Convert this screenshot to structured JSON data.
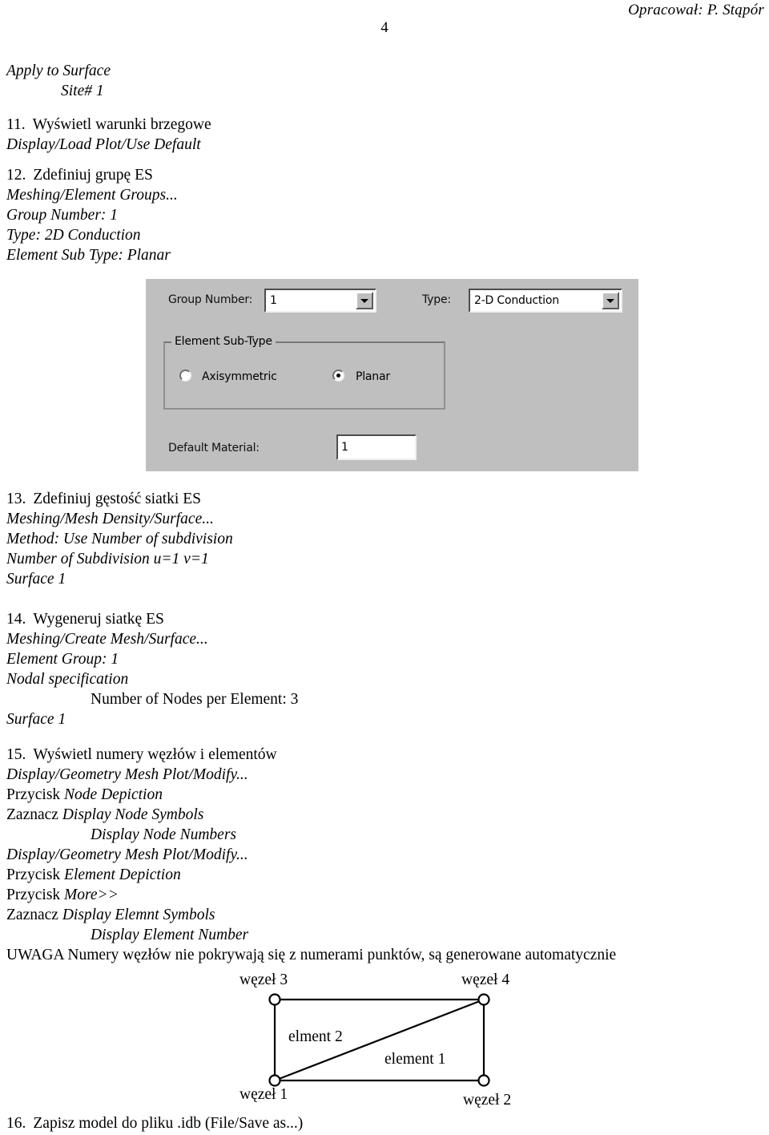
{
  "header": {
    "author": "Opracował:  P. Stąpór",
    "page_number": "4"
  },
  "top_block": {
    "line1": "Apply to Surface",
    "line2": "Site# 1"
  },
  "steps": [
    {
      "number": "11.",
      "title": "Wyświetl warunki brzegowe",
      "lines": [
        {
          "text": "Display/Load Plot/Use Default",
          "style": "italic",
          "indent": 0
        }
      ]
    },
    {
      "number": "12.",
      "title": "Zdefiniuj grupę ES",
      "lines": [
        {
          "text": "Meshing/Element Groups...",
          "style": "italic",
          "indent": 0
        },
        {
          "text": "Group Number: 1",
          "style": "italic",
          "indent": 0
        },
        {
          "text": "Type: 2D Conduction",
          "style": "italic",
          "indent": 0
        },
        {
          "text": "Element Sub Type: Planar",
          "style": "italic",
          "indent": 0
        }
      ]
    },
    {
      "number": "13.",
      "title": "Zdefiniuj gęstość siatki ES",
      "lines": [
        {
          "text": "Meshing/Mesh Density/Surface...",
          "style": "italic",
          "indent": 0
        },
        {
          "text": "Method: Use Number of subdivision",
          "style": "italic",
          "indent": 0
        },
        {
          "text": "Number of Subdivision u=1 v=1",
          "style": "italic",
          "indent": 0
        },
        {
          "text": "Surface 1",
          "style": "italic",
          "indent": 0
        }
      ]
    },
    {
      "number": "14.",
      "title": "Wygeneruj siatkę ES",
      "lines": [
        {
          "text": "Meshing/Create Mesh/Surface...",
          "style": "italic",
          "indent": 0
        },
        {
          "text": "Element Group: 1",
          "style": "italic",
          "indent": 0
        },
        {
          "text": "Nodal specification",
          "style": "italic",
          "indent": 0
        },
        {
          "text": "Number of Nodes per Element: 3",
          "style": "roman",
          "indent": 2
        },
        {
          "text": "Surface 1",
          "style": "italic",
          "indent": 0
        }
      ]
    },
    {
      "number": "15.",
      "title": "Wyświetl numery węzłów i elementów",
      "lines": [
        {
          "text": "Display/Geometry Mesh Plot/Modify...",
          "style": "italic",
          "indent": 0
        },
        {
          "text": "Przycisk Node Depiction",
          "style": "mixed",
          "indent": 0,
          "prefix": "Przycisk ",
          "emph": "Node Depiction"
        },
        {
          "text": "Zaznacz Display Node Symbols",
          "style": "mixed",
          "indent": 0,
          "prefix": "Zaznacz ",
          "emph": "Display Node Symbols"
        },
        {
          "text": "Display Node Numbers",
          "style": "italic",
          "indent": 2
        },
        {
          "text": "Display/Geometry Mesh Plot/Modify...",
          "style": "italic",
          "indent": 0
        },
        {
          "text": "Przycisk Element Depiction",
          "style": "mixed",
          "indent": 0,
          "prefix": "Przycisk ",
          "emph": "Element Depiction"
        },
        {
          "text": "Przycisk More>>",
          "style": "mixed",
          "indent": 0,
          "prefix": "Przycisk ",
          "emph": "More>>"
        },
        {
          "text": "Zaznacz Display Elemnt Symbols",
          "style": "mixed",
          "indent": 0,
          "prefix": "Zaznacz ",
          "emph": "Display Elemnt Symbols"
        },
        {
          "text": "Display Element Number",
          "style": "italic",
          "indent": 2
        },
        {
          "text": "UWAGA Numery węzłów nie pokrywają się z numerami punktów, są generowane automatycznie",
          "style": "roman",
          "indent": 0
        }
      ]
    },
    {
      "number": "16.",
      "title": "Zapisz model do pliku .idb (File/Save as...)",
      "lines": []
    }
  ],
  "dialog": {
    "group_number_label": "Group Number:",
    "group_number_value": "1",
    "type_label": "Type:",
    "type_value": "2-D Conduction",
    "element_sub_type_legend": "Element Sub-Type",
    "axisymmetric_label": "Axisymmetric",
    "axisymmetric_selected": false,
    "planar_label": "Planar",
    "planar_selected": true,
    "default_material_label": "Default Material:",
    "default_material_value": "1",
    "face_color": "#bfbfbf",
    "field_color": "#ffffff"
  },
  "mesh_diagram": {
    "node3_label": "węzeł 3",
    "node4_label": "węzeł 4",
    "node1_label": "węzeł 1",
    "node2_label": "węzeł 2",
    "element2_label": "elment 2",
    "element1_label": "element 1",
    "stroke_color": "#000000"
  }
}
